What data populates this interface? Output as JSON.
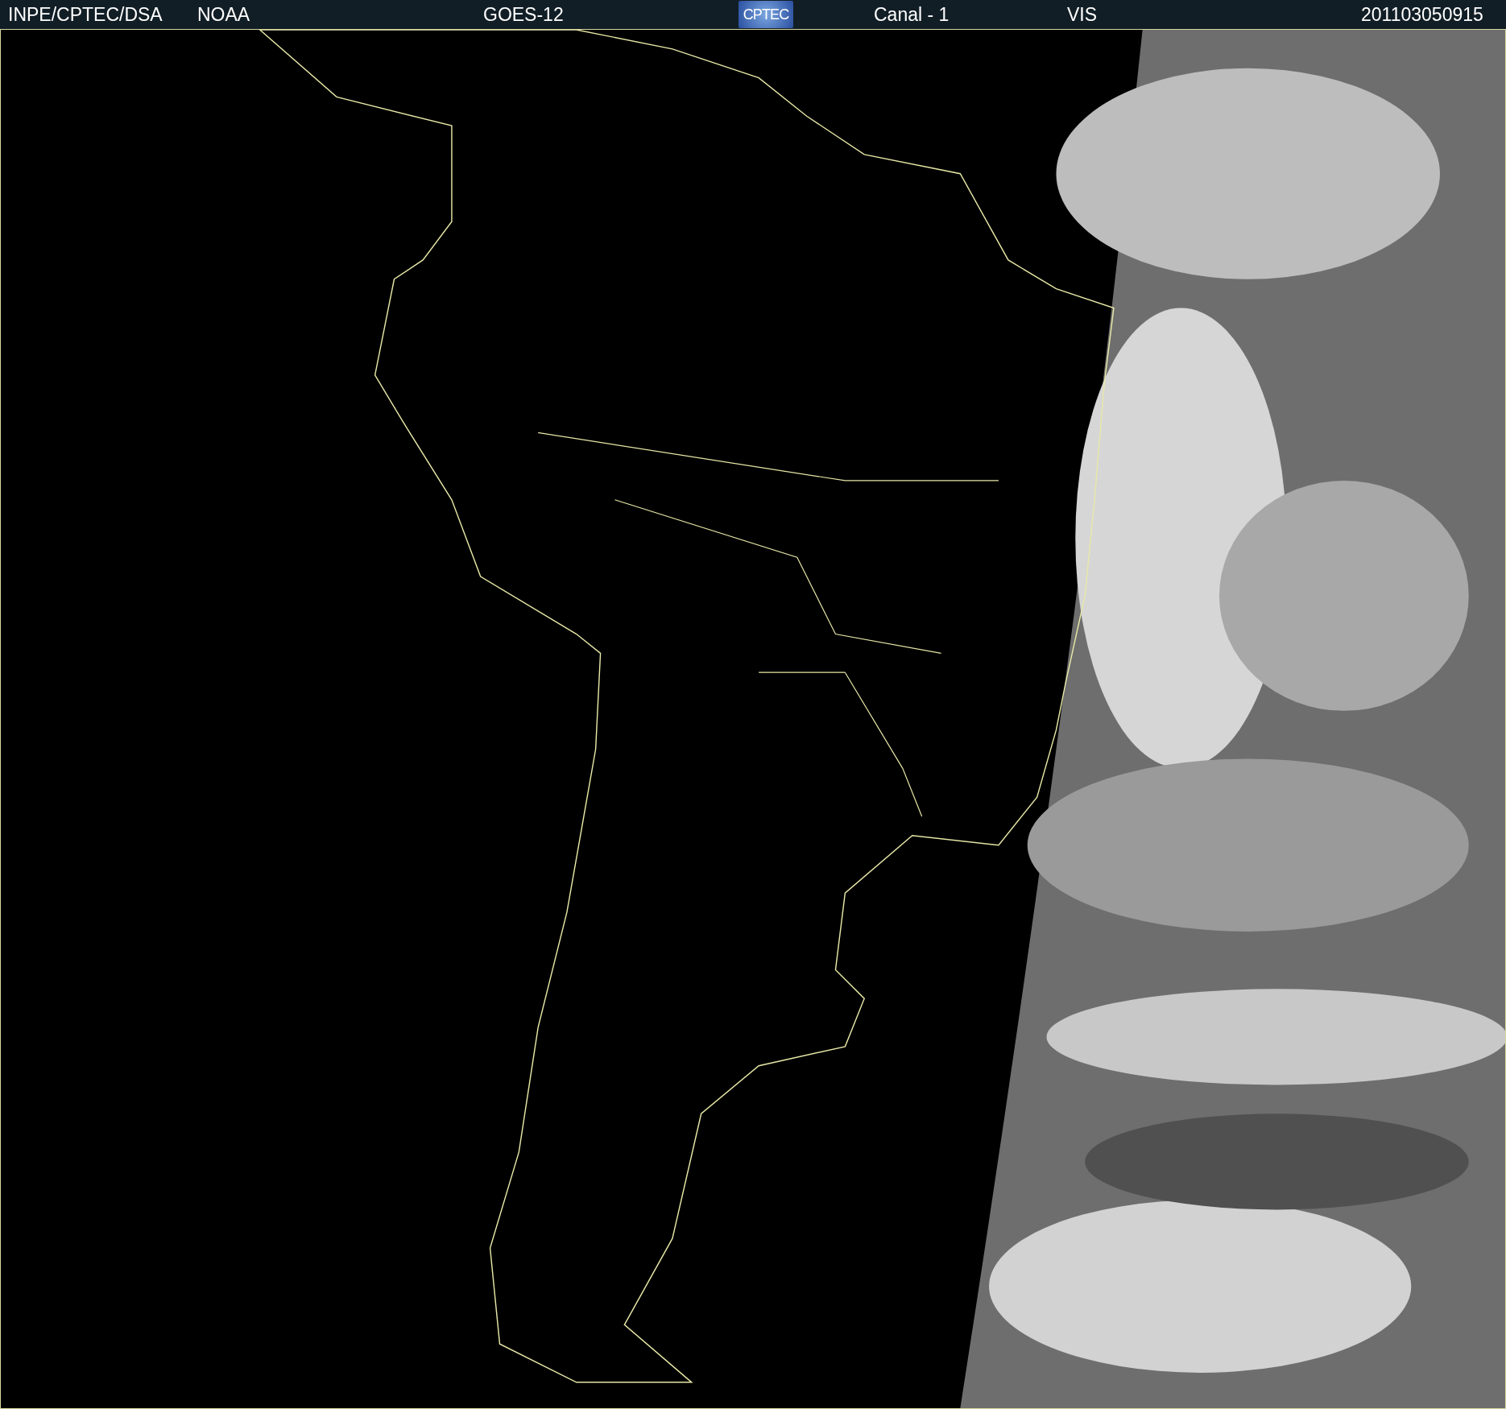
{
  "header": {
    "items": [
      {
        "kind": "text",
        "text": "INPE/CPTEC/DSA"
      },
      {
        "kind": "text",
        "text": "NOAA"
      },
      {
        "kind": "text",
        "text": "GOES-12"
      },
      {
        "kind": "logo",
        "text": "CPTEC"
      },
      {
        "kind": "text",
        "text": "Canal - 1"
      },
      {
        "kind": "text",
        "text": "VIS"
      },
      {
        "kind": "text",
        "text": "201103050915"
      }
    ]
  }
}
